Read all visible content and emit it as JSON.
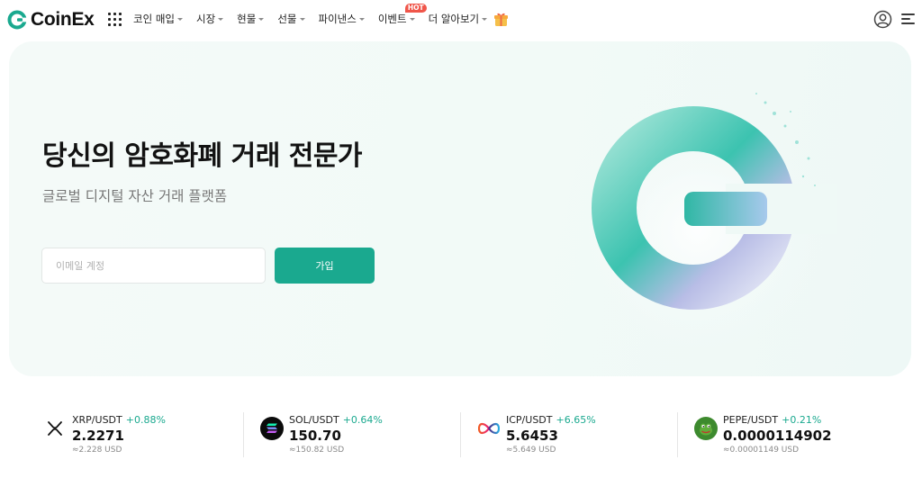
{
  "header": {
    "logo_text": "CoinEx",
    "nav": [
      {
        "label": "코인 매입"
      },
      {
        "label": "시장"
      },
      {
        "label": "현물"
      },
      {
        "label": "선물"
      },
      {
        "label": "파이낸스"
      },
      {
        "label": "이벤트",
        "badge": "HOT"
      },
      {
        "label": "더 알아보기"
      }
    ],
    "icons": [
      "apps-icon",
      "gift-icon",
      "user-icon",
      "menu-icon"
    ]
  },
  "hero": {
    "title": "당신의 암호화폐 거래 전문가",
    "subtitle": "글로벌 디지털 자산 거래 플랫폼",
    "email_placeholder": "이메일 계정",
    "signup_label": "가입"
  },
  "ticker": [
    {
      "pair": "XRP/USDT",
      "change": "+0.88%",
      "price": "2.2271",
      "usd": "≈2.228 USD",
      "icon": "xrp-icon"
    },
    {
      "pair": "SOL/USDT",
      "change": "+0.64%",
      "price": "150.70",
      "usd": "≈150.82 USD",
      "icon": "sol-icon"
    },
    {
      "pair": "ICP/USDT",
      "change": "+6.65%",
      "price": "5.6453",
      "usd": "≈5.649 USD",
      "icon": "icp-icon"
    },
    {
      "pair": "PEPE/USDT",
      "change": "+0.21%",
      "price": "0.0000114902",
      "usd": "≈0.00001149 USD",
      "icon": "pepe-icon"
    }
  ],
  "colors": {
    "brand": "#1aa98f",
    "positive": "#1aa98f",
    "hot_badge": "#f0564a",
    "hero_bg": "#f2faf7"
  }
}
